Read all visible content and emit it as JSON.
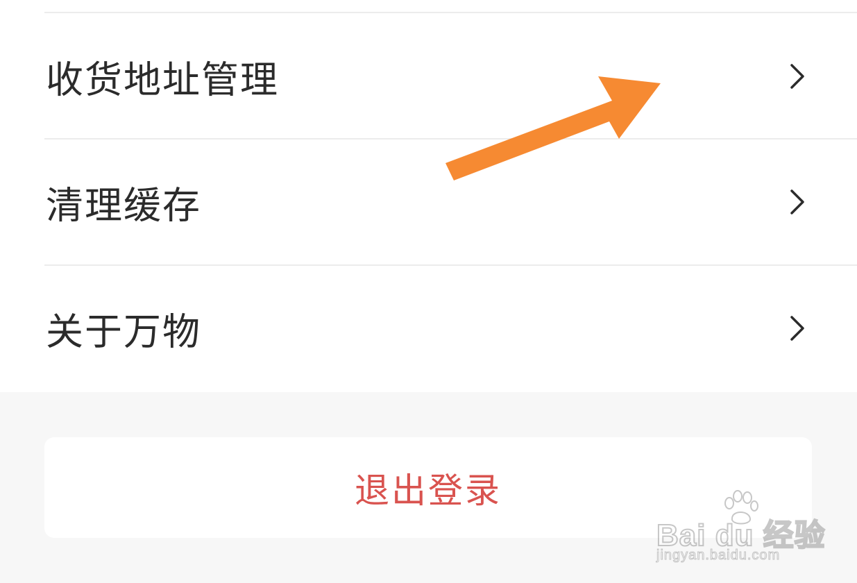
{
  "menu": {
    "items": [
      {
        "label": "收货地址管理",
        "icon": "chevron-right-icon"
      },
      {
        "label": "清理缓存",
        "icon": "chevron-right-icon"
      },
      {
        "label": "关于万物",
        "icon": "chevron-right-icon"
      }
    ]
  },
  "logout": {
    "label": "退出登录",
    "color": "#d9534f"
  },
  "overlay": {
    "icon": "pointer-arrow-icon",
    "color": "#f68a32"
  },
  "watermark": {
    "brand": "Bai du 经验",
    "url": "jingyan.baidu.com"
  },
  "colors": {
    "text": "#2b2b2b",
    "divider": "#ececec",
    "page_background": "#f7f7f7",
    "panel_background": "#ffffff"
  }
}
